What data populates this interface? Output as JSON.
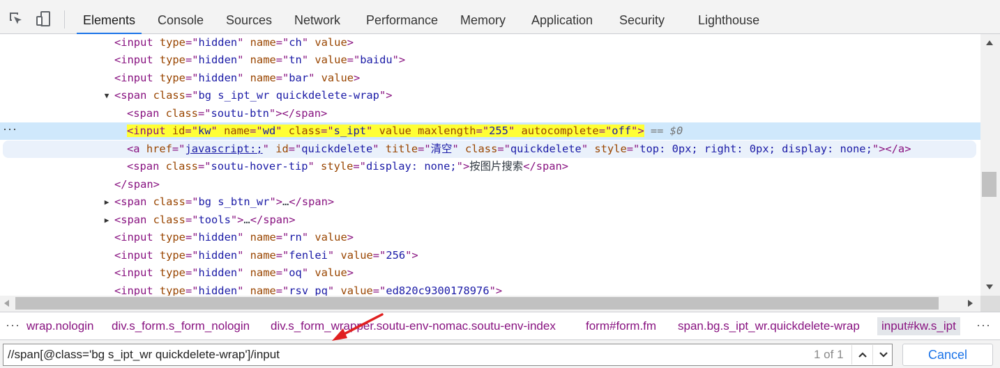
{
  "tabs": [
    "Elements",
    "Console",
    "Sources",
    "Network",
    "Performance",
    "Memory",
    "Application",
    "Security",
    "Lighthouse"
  ],
  "active_tab": "Elements",
  "tree": {
    "r0": {
      "tag1": "<input",
      "a1": " type",
      "eq1": "=\"",
      "v1": "hidden",
      "q1": "\"",
      "a2": " name",
      "eq2": "=\"",
      "v2": "ch",
      "q2": "\"",
      "a3": " value",
      "end": ">"
    },
    "r1": {
      "tag1": "<input",
      "a1": " type",
      "eq1": "=\"",
      "v1": "hidden",
      "q1": "\"",
      "a2": " name",
      "eq2": "=\"",
      "v2": "tn",
      "q2": "\"",
      "a3": " value",
      "eq3": "=\"",
      "v3": "baidu",
      "q3": "\"",
      "end": ">"
    },
    "r2": {
      "tag1": "<input",
      "a1": " type",
      "eq1": "=\"",
      "v1": "hidden",
      "q1": "\"",
      "a2": " name",
      "eq2": "=\"",
      "v2": "bar",
      "q2": "\"",
      "a3": " value",
      "end": ">"
    },
    "r3": {
      "tag1": "<span",
      "a1": " class",
      "eq1": "=\"",
      "v1": "bg s_ipt_wr quickdelete-wrap",
      "q1": "\"",
      "end": ">"
    },
    "r4": {
      "tag1": "<span",
      "a1": " class",
      "eq1": "=\"",
      "v1": "soutu-btn",
      "q1": "\"",
      "end": "></span>"
    },
    "r5": {
      "tag1": "<input",
      "a1": " id",
      "eq1": "=\"",
      "v1": "kw",
      "q1": "\"",
      "a2": " name",
      "eq2": "=\"",
      "v2": "wd",
      "q2": "\"",
      "a3": " class",
      "eq3": "=\"",
      "v3": "s_ipt",
      "q3": "\"",
      "a4": " value",
      "a5": " maxlength",
      "eq5": "=\"",
      "v5": "255",
      "q5": "\"",
      "a6": " autocomplete",
      "eq6": "=\"",
      "v6": "off",
      "q6": "\"",
      "end": ">",
      "dollar": " == $0"
    },
    "r6": {
      "tag1": "<a",
      "a1": " href",
      "eq1": "=\"",
      "v1": "javascript:;",
      "q1": "\"",
      "a2": " id",
      "eq2": "=\"",
      "v2": "quickdelete",
      "q2": "\"",
      "a3": " title",
      "eq3": "=\"",
      "v3": "清空",
      "q3": "\"",
      "a4": " class",
      "eq4": "=\"",
      "v4": "quickdelete",
      "q4": "\"",
      "a5": " style",
      "eq5": "=\"",
      "v5": "top: 0px; right: 0px; display: none;",
      "q5": "\"",
      "end": "></a>"
    },
    "r7": {
      "tag1": "<span",
      "a1": " class",
      "eq1": "=\"",
      "v1": "soutu-hover-tip",
      "q1": "\"",
      "a2": " style",
      "eq2": "=\"",
      "v2": "display: none;",
      "q2": "\"",
      "mid": ">",
      "text": "按图片搜索",
      "end": "</span>"
    },
    "r8": {
      "end": "</span>"
    },
    "r9": {
      "tag1": "<span",
      "a1": " class",
      "eq1": "=\"",
      "v1": "bg s_btn_wr",
      "q1": "\"",
      "mid": ">",
      "text": "…",
      "end": "</span>"
    },
    "r10": {
      "tag1": "<span",
      "a1": " class",
      "eq1": "=\"",
      "v1": "tools",
      "q1": "\"",
      "mid": ">",
      "text": "…",
      "end": "</span>"
    },
    "r11": {
      "tag1": "<input",
      "a1": " type",
      "eq1": "=\"",
      "v1": "hidden",
      "q1": "\"",
      "a2": " name",
      "eq2": "=\"",
      "v2": "rn",
      "q2": "\"",
      "a3": " value",
      "end": ">"
    },
    "r12": {
      "tag1": "<input",
      "a1": " type",
      "eq1": "=\"",
      "v1": "hidden",
      "q1": "\"",
      "a2": " name",
      "eq2": "=\"",
      "v2": "fenlei",
      "q2": "\"",
      "a3": " value",
      "eq3": "=\"",
      "v3": "256",
      "q3": "\"",
      "end": ">"
    },
    "r13": {
      "tag1": "<input",
      "a1": " type",
      "eq1": "=\"",
      "v1": "hidden",
      "q1": "\"",
      "a2": " name",
      "eq2": "=\"",
      "v2": "oq",
      "q2": "\"",
      "a3": " value",
      "end": ">"
    },
    "r14": {
      "tag1": "<input",
      "a1": " type",
      "eq1": "=\"",
      "v1": "hidden",
      "q1": "\"",
      "a2": " name",
      "eq2": "=\"",
      "v2": "rsv_pq",
      "q2": "\"",
      "a3": " value",
      "eq3": "=\"",
      "v3": "ed820c9300178976",
      "q3": "\"",
      "end": ">"
    }
  },
  "breadcrumbs": {
    "c0": "wrap.nologin",
    "c1": "div.s_form.s_form_nologin",
    "c2": "div.s_form_wrapper.soutu-env-nomac.soutu-env-index",
    "c3": "form#form.fm",
    "c4": "span.bg.s_ipt_wr.quickdelete-wrap",
    "c5": "input#kw.s_ipt"
  },
  "search": {
    "query": "//span[@class='bg s_ipt_wr quickdelete-wrap']/input",
    "match_count": "1 of 1",
    "cancel_label": "Cancel"
  },
  "colors": {
    "tag": "#881280",
    "attr": "#994500",
    "value": "#1a1aa6",
    "selection": "#cfe8fc",
    "highlight": "#ffff35",
    "accent": "#1a73e8",
    "annotation_arrow": "#e02020"
  },
  "icons": [
    "inspect-element-icon",
    "device-toolbar-icon",
    "expand-caret-icon",
    "collapse-caret-icon",
    "more-dots-icon",
    "arrow-up-icon",
    "arrow-down-icon"
  ]
}
